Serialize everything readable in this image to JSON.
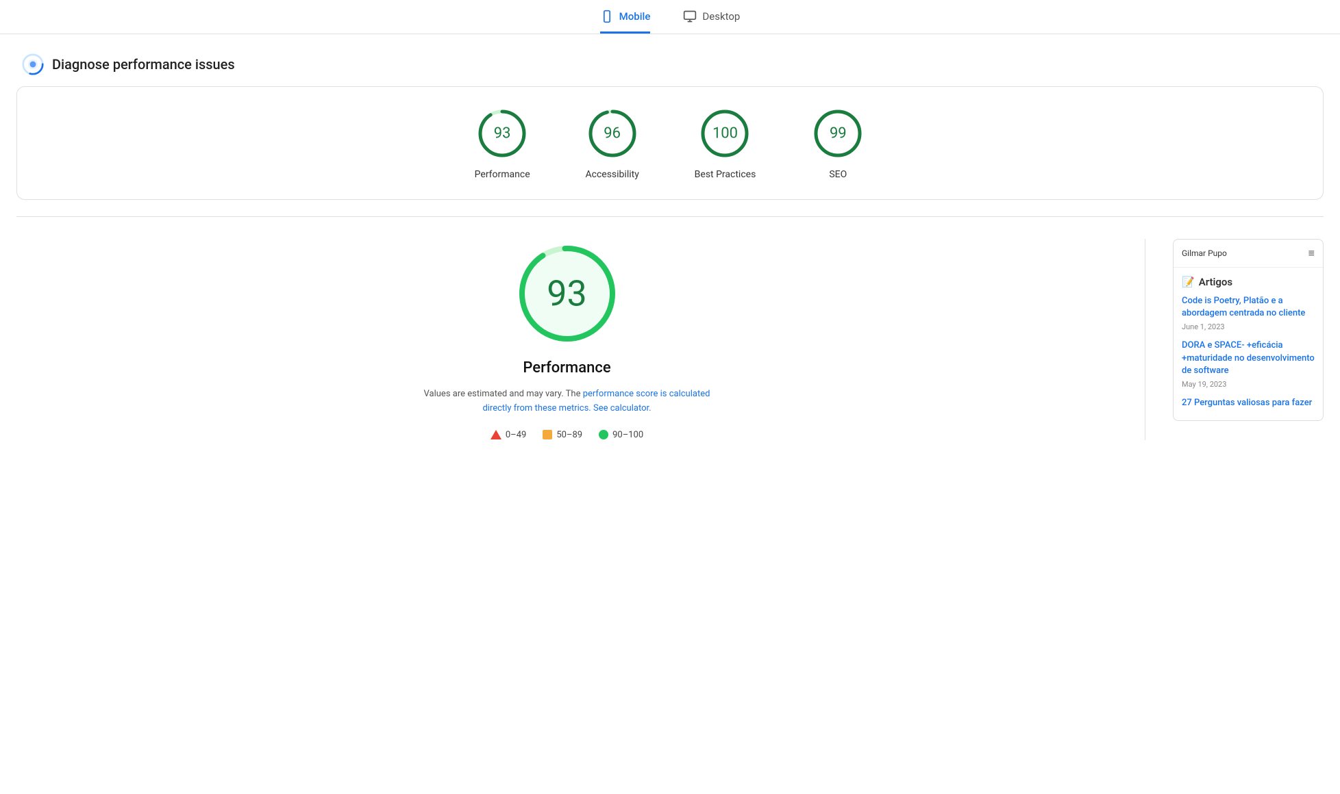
{
  "tabs": [
    {
      "id": "mobile",
      "label": "Mobile",
      "active": true
    },
    {
      "id": "desktop",
      "label": "Desktop",
      "active": false
    }
  ],
  "section": {
    "title": "Diagnose performance issues"
  },
  "scores": [
    {
      "id": "performance",
      "value": 93,
      "label": "Performance",
      "color": "#1a7c3e",
      "track": "#c8f5d0"
    },
    {
      "id": "accessibility",
      "value": 96,
      "label": "Accessibility",
      "color": "#1a7c3e",
      "track": "#c8f5d0"
    },
    {
      "id": "best-practices",
      "value": 100,
      "label": "Best Practices",
      "color": "#1a7c3e",
      "track": "#c8f5d0"
    },
    {
      "id": "seo",
      "value": 99,
      "label": "SEO",
      "color": "#1a7c3e",
      "track": "#c8f5d0"
    }
  ],
  "performance_detail": {
    "score": 93,
    "title": "Performance",
    "description": "Values are estimated and may vary. The",
    "link1_text": "performance score is calculated",
    "link1_suffix": "directly from these metrics.",
    "link2_text": "See calculator.",
    "legend": [
      {
        "type": "triangle",
        "range": "0–49",
        "color": "#e94235"
      },
      {
        "type": "square",
        "range": "50–89",
        "color": "#f4a93d"
      },
      {
        "type": "dot",
        "range": "90–100",
        "color": "#1db954"
      }
    ]
  },
  "preview": {
    "header_name": "Gilmar Pupo",
    "section_emoji": "📝",
    "section_title": "Artigos",
    "articles": [
      {
        "title": "Code is Poetry, Platão e a abordagem centrada no cliente",
        "date": "June 1, 2023"
      },
      {
        "title": "DORA e SPACE- +eficácia +maturidade no desenvolvimento de software",
        "date": "May 19, 2023"
      },
      {
        "title": "27 Perguntas valiosas para fazer",
        "date": ""
      }
    ]
  },
  "icons": {
    "mobile": "📱",
    "desktop": "🖥"
  }
}
